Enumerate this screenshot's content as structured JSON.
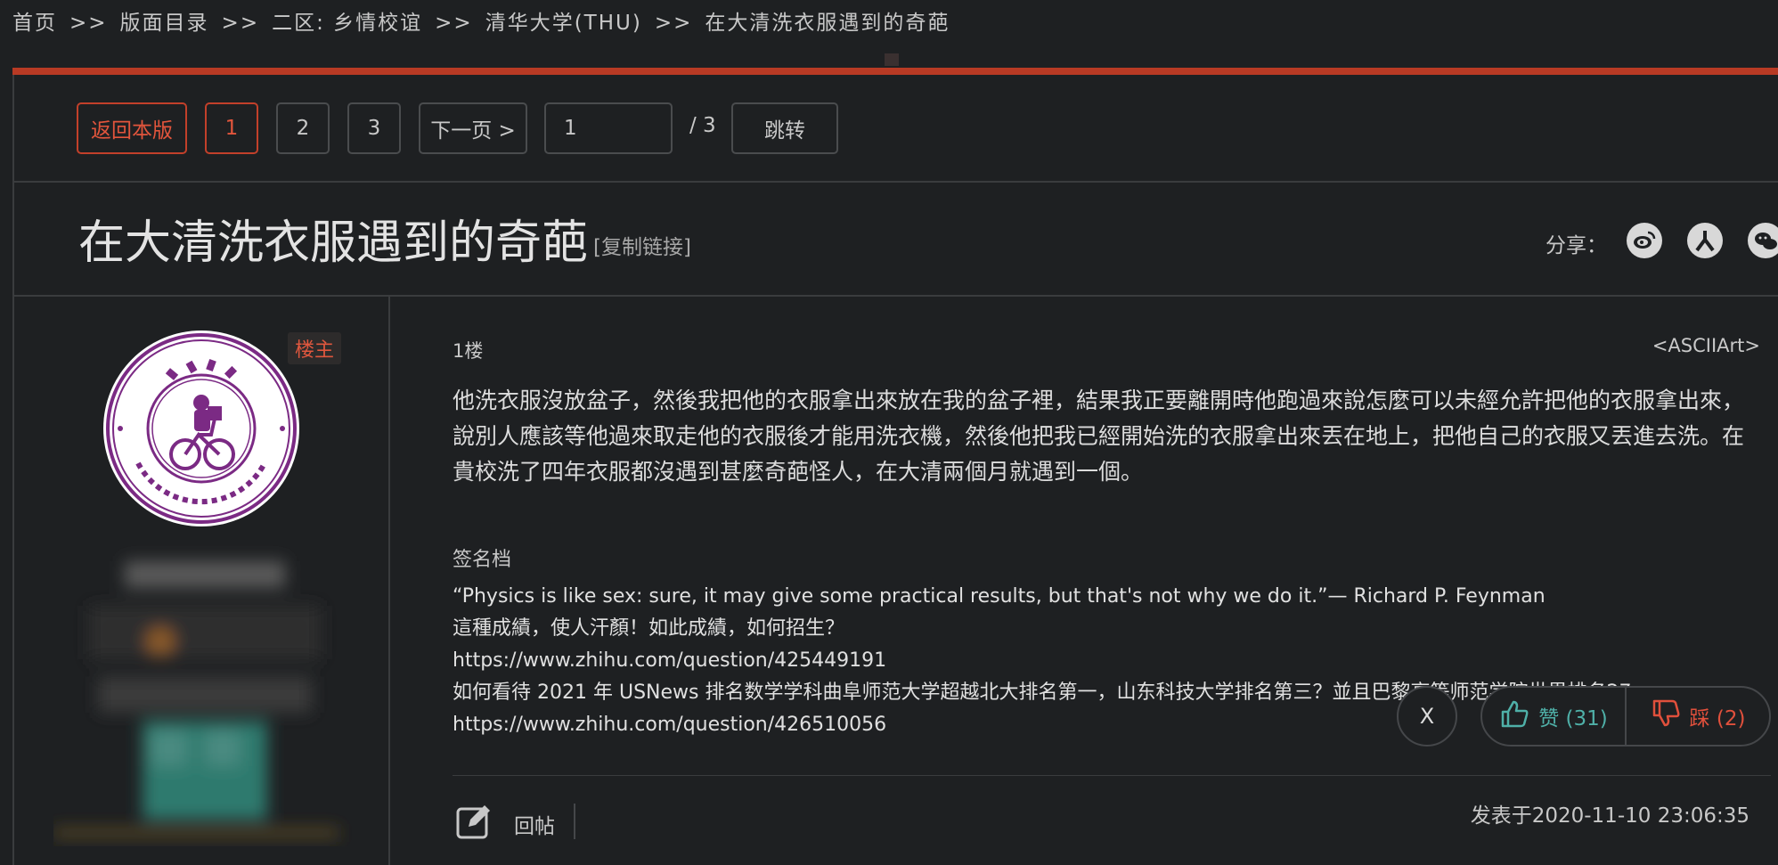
{
  "breadcrumb": {
    "items": [
      "首页",
      "版面目录",
      "二区: 乡情校谊",
      "清华大学(THU)",
      "在大清洗衣服遇到的奇葩"
    ],
    "separator": ">>"
  },
  "pager": {
    "back_label": "返回本版",
    "pages": [
      "1",
      "2",
      "3"
    ],
    "current_page": "1",
    "next_label": "下一页 >",
    "page_input": "1",
    "total": "/ 3",
    "jump_label": "跳转"
  },
  "thread": {
    "title": "在大清洗衣服遇到的奇葩",
    "copy_link": "[复制链接]",
    "share_label": "分享："
  },
  "post": {
    "badge": "楼主",
    "floor": "1楼",
    "author": "<ASCIIArt>",
    "content": "他洗衣服沒放盆子，然後我把他的衣服拿出來放在我的盆子裡，結果我正要離開時他跑過來說怎麼可以未經允許把他的衣服拿出來，說別人應該等他過來取走他的衣服後才能用洗衣機，然後他把我已經開始洗的衣服拿出來丟在地上，把他自己的衣服又丟進去洗。在貴校洗了四年衣服都沒遇到甚麼奇葩怪人，在大清兩個月就遇到一個。",
    "signature_label": "签名档",
    "signature_lines": [
      "“Physics is like sex: sure, it may give some practical results, but that's not why we do it.”— Richard P. Feynman",
      "這種成績，使人汗顏！如此成績，如何招生？",
      "https://www.zhihu.com/question/425449191",
      "如何看待 2021 年 USNews 排名数学学科曲阜师范大学超越北大排名第一，山东科技大学排名第三？並且巴黎高等师范学院世界排名27",
      "https://www.zhihu.com/question/426510056"
    ],
    "close_label": "X",
    "like_label": "赞 (31)",
    "dislike_label": "踩 (2)",
    "reply_label": "回帖",
    "posted_at": "发表于2020-11-10 23:06:35"
  },
  "colors": {
    "accent_red": "#c2402a",
    "like_teal": "#4fb0a8",
    "dislike_red": "#e0503c",
    "logo_purple": "#7b2a84"
  }
}
